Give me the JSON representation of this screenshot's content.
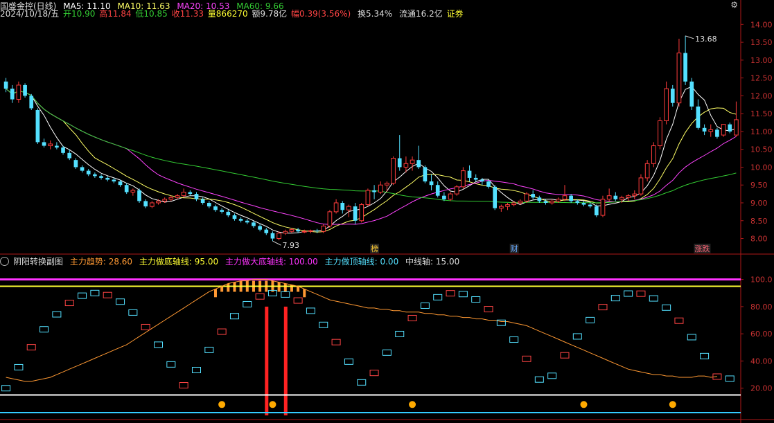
{
  "header": {
    "stock_name": "国盛金控(日线)",
    "ma5": "MA5: 11.10",
    "ma10": "MA10: 11.63",
    "ma20": "MA20: 10.53",
    "ma60": "MA60: 9.66",
    "date": "2024/10/18/五",
    "open": "开10.90",
    "high": "高11.84",
    "low": "低10.85",
    "close": "收11.33",
    "volume": "量866270",
    "amount": "额9.78亿",
    "change": "幅0.39(3.56%)",
    "turnover": "换5.34%",
    "float": "流通16.2亿",
    "sector": "证券"
  },
  "sub_header": {
    "name": "阴阳转换副图",
    "trend": "主力趋势: 28.60",
    "bottom_axis": "主力做底轴线: 95.00",
    "big_bottom_axis": "主力做大底轴线: 100.00",
    "top_axis": "主力做顶轴线: 0.00",
    "mid_axis": "中线轴: 15.00"
  },
  "colors": {
    "up": "#ff3c3c",
    "down": "#54e0ff",
    "ma5": "#ffffff",
    "ma10": "#ffff66",
    "ma20": "#ff44ff",
    "ma60": "#33cc33",
    "trend": "#ff9933",
    "magenta_line": "#ff33ff",
    "yellow_line": "#ffff33"
  },
  "chart_data": [
    {
      "type": "candlestick",
      "title": "国盛金控(日线)",
      "ylim": [
        7.7,
        14.2
      ],
      "y_ticks": [
        "14.00",
        "13.50",
        "13.00",
        "12.50",
        "12.00",
        "11.50",
        "11.00",
        "10.50",
        "10.00",
        "9.50",
        "9.00",
        "8.50",
        "8.00"
      ],
      "annotations": {
        "high_label": "13.68",
        "low_label": "7.93"
      },
      "event_markers": [
        "榜",
        "财",
        "涨跌"
      ],
      "series": [
        {
          "name": "MA5",
          "values_ref": "close_ma"
        },
        {
          "name": "MA10"
        },
        {
          "name": "MA20"
        },
        {
          "name": "MA60"
        }
      ],
      "ohlc": [
        [
          12.4,
          12.5,
          12.1,
          12.2
        ],
        [
          12.2,
          12.3,
          11.8,
          11.9
        ],
        [
          11.9,
          12.4,
          11.8,
          12.3
        ],
        [
          12.3,
          12.35,
          11.95,
          12.0
        ],
        [
          12.0,
          12.05,
          11.6,
          11.65
        ],
        [
          11.6,
          11.65,
          10.65,
          10.7
        ],
        [
          10.7,
          10.8,
          10.55,
          10.6
        ],
        [
          10.6,
          10.75,
          10.5,
          10.65
        ],
        [
          10.6,
          10.7,
          10.5,
          10.55
        ],
        [
          10.55,
          10.6,
          10.35,
          10.4
        ],
        [
          10.4,
          10.5,
          10.2,
          10.25
        ],
        [
          10.2,
          10.25,
          9.95,
          10.0
        ],
        [
          10.0,
          10.05,
          9.85,
          9.9
        ],
        [
          9.9,
          9.95,
          9.75,
          9.8
        ],
        [
          9.8,
          9.85,
          9.7,
          9.75
        ],
        [
          9.75,
          9.8,
          9.65,
          9.7
        ],
        [
          9.7,
          9.75,
          9.6,
          9.65
        ],
        [
          9.65,
          9.7,
          9.55,
          9.6
        ],
        [
          9.6,
          9.65,
          9.45,
          9.5
        ],
        [
          9.5,
          9.55,
          9.25,
          9.3
        ],
        [
          9.3,
          9.4,
          9.2,
          9.35
        ],
        [
          9.35,
          9.4,
          9.0,
          9.05
        ],
        [
          9.05,
          9.1,
          8.85,
          8.9
        ],
        [
          8.9,
          9.05,
          8.85,
          9.0
        ],
        [
          9.0,
          9.1,
          8.95,
          9.05
        ],
        [
          9.05,
          9.15,
          9.0,
          9.1
        ],
        [
          9.1,
          9.2,
          9.05,
          9.15
        ],
        [
          9.15,
          9.25,
          9.1,
          9.2
        ],
        [
          9.2,
          9.4,
          9.15,
          9.3
        ],
        [
          9.3,
          9.35,
          9.2,
          9.25
        ],
        [
          9.25,
          9.3,
          9.05,
          9.1
        ],
        [
          9.1,
          9.15,
          8.95,
          9.0
        ],
        [
          9.0,
          9.05,
          8.85,
          8.9
        ],
        [
          8.9,
          8.95,
          8.75,
          8.8
        ],
        [
          8.8,
          8.85,
          8.7,
          8.75
        ],
        [
          8.75,
          8.8,
          8.6,
          8.65
        ],
        [
          8.65,
          8.7,
          8.5,
          8.55
        ],
        [
          8.55,
          8.6,
          8.45,
          8.5
        ],
        [
          8.5,
          8.55,
          8.4,
          8.45
        ],
        [
          8.45,
          8.5,
          8.3,
          8.35
        ],
        [
          8.35,
          8.4,
          8.2,
          8.25
        ],
        [
          8.25,
          8.3,
          8.1,
          8.15
        ],
        [
          8.15,
          8.2,
          7.93,
          8.0
        ],
        [
          8.0,
          8.2,
          7.95,
          8.15
        ],
        [
          8.15,
          8.25,
          8.1,
          8.2
        ],
        [
          8.2,
          8.3,
          8.15,
          8.25
        ],
        [
          8.25,
          8.3,
          8.15,
          8.2
        ],
        [
          8.2,
          8.25,
          8.15,
          8.2
        ],
        [
          8.2,
          8.25,
          8.15,
          8.22
        ],
        [
          8.22,
          8.27,
          8.15,
          8.2
        ],
        [
          8.2,
          8.4,
          8.15,
          8.35
        ],
        [
          8.35,
          8.8,
          8.3,
          8.75
        ],
        [
          8.75,
          9.1,
          8.7,
          9.0
        ],
        [
          9.0,
          9.05,
          8.7,
          8.8
        ],
        [
          8.8,
          8.95,
          8.6,
          8.9
        ],
        [
          8.9,
          9.0,
          8.4,
          8.5
        ],
        [
          8.5,
          9.0,
          8.45,
          8.95
        ],
        [
          8.95,
          9.4,
          8.9,
          9.35
        ],
        [
          9.35,
          9.5,
          9.1,
          9.3
        ],
        [
          9.3,
          9.6,
          9.25,
          9.5
        ],
        [
          9.5,
          9.6,
          9.3,
          9.55
        ],
        [
          9.55,
          10.3,
          9.5,
          10.25
        ],
        [
          10.25,
          10.9,
          9.9,
          10.0
        ],
        [
          10.0,
          10.3,
          9.85,
          10.1
        ],
        [
          10.1,
          10.3,
          9.9,
          10.2
        ],
        [
          10.2,
          10.6,
          9.95,
          10.0
        ],
        [
          10.0,
          10.05,
          9.55,
          9.6
        ],
        [
          9.6,
          9.8,
          9.35,
          9.5
        ],
        [
          9.5,
          9.6,
          9.15,
          9.2
        ],
        [
          9.2,
          9.3,
          9.05,
          9.1
        ],
        [
          9.1,
          9.3,
          9.05,
          9.25
        ],
        [
          9.25,
          9.5,
          9.2,
          9.45
        ],
        [
          9.45,
          10.0,
          9.4,
          9.9
        ],
        [
          9.9,
          10.05,
          9.6,
          9.7
        ],
        [
          9.7,
          9.8,
          9.6,
          9.65
        ],
        [
          9.65,
          9.7,
          9.5,
          9.6
        ],
        [
          9.6,
          9.65,
          9.4,
          9.45
        ],
        [
          9.45,
          9.5,
          8.8,
          8.85
        ],
        [
          8.85,
          8.95,
          8.75,
          8.9
        ],
        [
          8.9,
          9.0,
          8.8,
          8.95
        ],
        [
          8.95,
          9.05,
          8.9,
          9.0
        ],
        [
          9.0,
          9.1,
          8.95,
          9.05
        ],
        [
          9.05,
          9.3,
          9.0,
          9.25
        ],
        [
          9.25,
          9.35,
          9.1,
          9.15
        ],
        [
          9.15,
          9.2,
          9.0,
          9.05
        ],
        [
          9.05,
          9.1,
          8.95,
          9.0
        ],
        [
          9.0,
          9.1,
          8.95,
          9.05
        ],
        [
          9.05,
          9.15,
          9.0,
          9.1
        ],
        [
          9.1,
          9.5,
          9.05,
          9.2
        ],
        [
          9.2,
          9.25,
          9.0,
          9.05
        ],
        [
          9.05,
          9.1,
          8.95,
          9.0
        ],
        [
          9.0,
          9.05,
          8.9,
          8.95
        ],
        [
          8.95,
          9.0,
          8.85,
          8.9
        ],
        [
          8.9,
          8.95,
          8.6,
          8.65
        ],
        [
          8.65,
          9.2,
          8.6,
          9.1
        ],
        [
          9.1,
          9.4,
          9.05,
          9.2
        ],
        [
          9.2,
          9.3,
          9.05,
          9.1
        ],
        [
          9.1,
          9.2,
          9.0,
          9.15
        ],
        [
          9.15,
          9.25,
          9.05,
          9.2
        ],
        [
          9.2,
          9.35,
          9.1,
          9.25
        ],
        [
          9.25,
          9.8,
          9.2,
          9.7
        ],
        [
          9.7,
          10.2,
          9.6,
          10.1
        ],
        [
          10.1,
          10.7,
          10.0,
          10.6
        ],
        [
          10.6,
          11.4,
          10.5,
          11.3
        ],
        [
          11.3,
          12.4,
          11.2,
          12.2
        ],
        [
          12.2,
          12.3,
          11.7,
          11.8
        ],
        [
          11.8,
          13.6,
          11.7,
          13.2
        ],
        [
          13.2,
          13.68,
          12.3,
          12.4
        ],
        [
          12.4,
          12.5,
          11.6,
          11.7
        ],
        [
          11.7,
          11.9,
          11.05,
          11.1
        ],
        [
          11.1,
          11.2,
          10.9,
          11.0
        ],
        [
          11.0,
          11.2,
          10.85,
          11.05
        ],
        [
          11.05,
          11.1,
          10.8,
          10.85
        ],
        [
          10.9,
          11.2,
          10.85,
          11.2
        ],
        [
          11.2,
          11.25,
          10.95,
          11.0
        ],
        [
          10.9,
          11.84,
          10.85,
          11.33
        ]
      ]
    },
    {
      "type": "line",
      "title": "阴阳转换副图",
      "ylim": [
        0,
        110
      ],
      "y_ticks": [
        "100.0",
        "80.00",
        "60.00",
        "40.00",
        "20.00"
      ],
      "series": [
        {
          "name": "主力趋势",
          "values": [
            28,
            27,
            26,
            25,
            25,
            26,
            27,
            28,
            30,
            32,
            34,
            36,
            38,
            40,
            42,
            44,
            46,
            48,
            50,
            52,
            55,
            58,
            61,
            64,
            67,
            70,
            73,
            76,
            79,
            82,
            85,
            88,
            91,
            93,
            95,
            97,
            98,
            99,
            99,
            100,
            100,
            100,
            99,
            98,
            97,
            96,
            95,
            93,
            91,
            89,
            87,
            85,
            84,
            83,
            82,
            81,
            80,
            79,
            79,
            78,
            78,
            77,
            77,
            76,
            76,
            76,
            75,
            75,
            74,
            74,
            73,
            73,
            72,
            72,
            71,
            71,
            70,
            70,
            69,
            69,
            68,
            67,
            66,
            64,
            62,
            60,
            58,
            56,
            54,
            52,
            50,
            48,
            46,
            44,
            42,
            40,
            38,
            36,
            34,
            33,
            32,
            31,
            30,
            30,
            29,
            29,
            28,
            28,
            28,
            29,
            29,
            28,
            28.6
          ]
        },
        {
          "name": "主力做大底轴线",
          "values": [
            100
          ]
        },
        {
          "name": "主力做底轴线",
          "values": [
            95
          ]
        },
        {
          "name": "中线轴",
          "values": [
            15
          ]
        },
        {
          "name": "主力做顶轴线",
          "values": [
            0
          ]
        }
      ]
    }
  ]
}
